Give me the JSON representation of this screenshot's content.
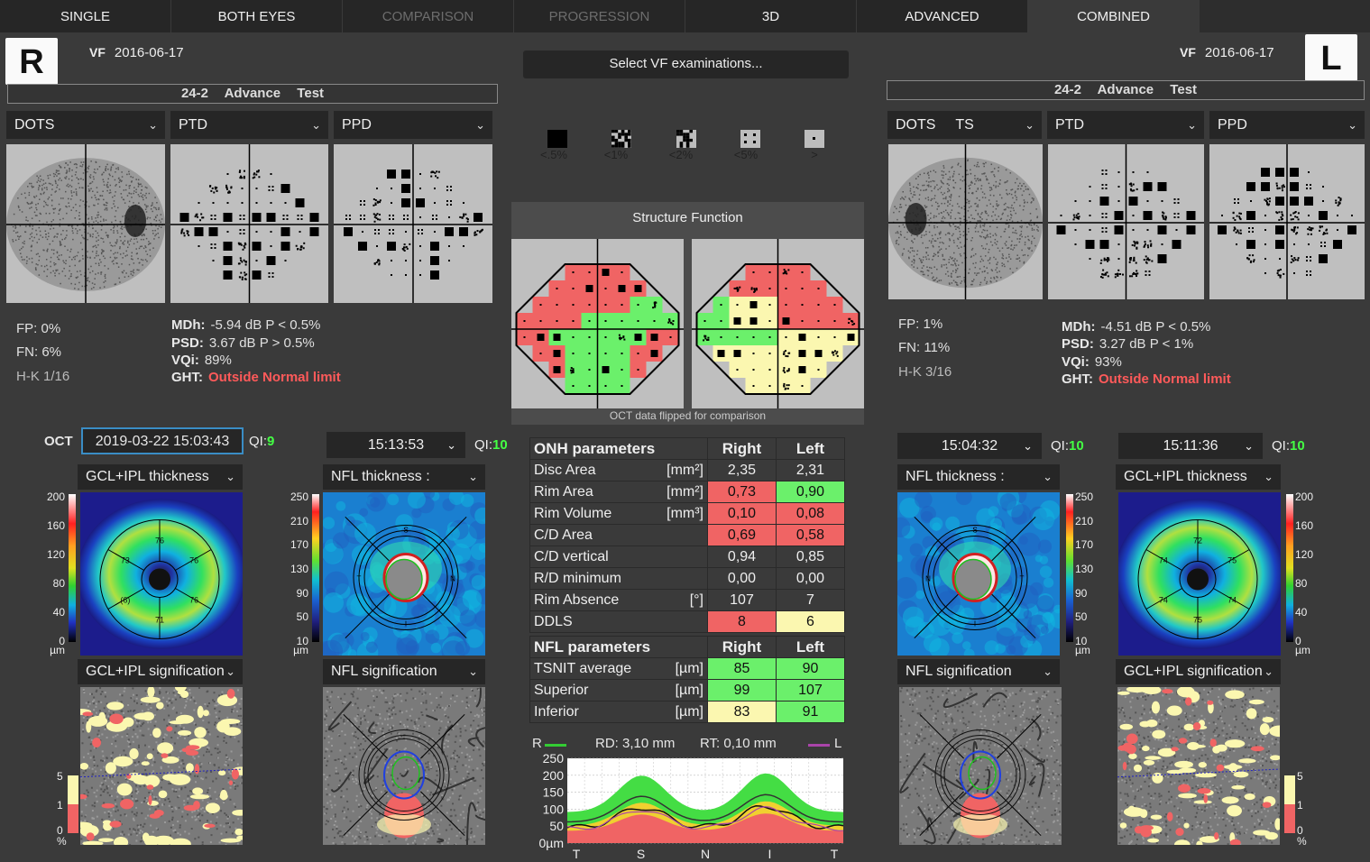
{
  "tabs": [
    {
      "label": "SINGLE",
      "state": "normal"
    },
    {
      "label": "BOTH EYES",
      "state": "normal"
    },
    {
      "label": "COMPARISON",
      "state": "disabled"
    },
    {
      "label": "PROGRESSION",
      "state": "disabled"
    },
    {
      "label": "3D",
      "state": "normal"
    },
    {
      "label": "ADVANCED",
      "state": "normal"
    },
    {
      "label": "COMBINED",
      "state": "active"
    }
  ],
  "right_eye": {
    "letter": "R",
    "vf_label": "VF",
    "vf_date": "2016-06-17",
    "test": "24-2 Advance Test",
    "dropdowns": [
      "DOTS",
      "PTD",
      "PPD"
    ],
    "fp": "FP:  0%",
    "fn": "FN:  6%",
    "hk": "H-K  1/16",
    "mdh_label": "MDh:",
    "mdh": "-5.94 dB P < 0.5%",
    "psd_label": "PSD:",
    "psd": "3.67 dB P > 0.5%",
    "vqi_label": "VQi:",
    "vqi": "89%",
    "ght_label": "GHT:",
    "ght": "Outside Normal limit"
  },
  "left_eye": {
    "letter": "L",
    "vf_label": "VF",
    "vf_date": "2016-06-17",
    "test": "24-2 Advance Test",
    "dropdowns": [
      "DOTS     TS",
      "PTD",
      "PPD"
    ],
    "fp": "FP:  1%",
    "fn": "FN:  11%",
    "hk": "H-K  3/16",
    "mdh_label": "MDh:",
    "mdh": "-4.51 dB P < 0.5%",
    "psd_label": "PSD:",
    "psd": "3.27 dB P < 1%",
    "vqi_label": "VQi:",
    "vqi": "93%",
    "ght_label": "GHT:",
    "ght": "Outside Normal limit"
  },
  "center": {
    "select_button": "Select VF examinations...",
    "prob_legend": [
      "<.5%",
      "<1%",
      "<2%",
      "<5%",
      ">"
    ],
    "structure_function": "Structure Function",
    "flip_note": "OCT data flipped for comparison"
  },
  "oct": {
    "label": "OCT",
    "date": "2019-03-22 15:03:43",
    "qi_label": "QI:",
    "qi_main": "9",
    "r_time": "15:13:53",
    "r_qi": "10",
    "l_time1": "15:04:32",
    "l_qi1": "10",
    "l_time2": "15:11:36",
    "l_qi2": "10",
    "gcl_thickness": "GCL+IPL thickness",
    "nfl_thickness": "NFL thickness :",
    "gcl_sig": "GCL+IPL signification",
    "nfl_sig": "NFL signification",
    "gcl_scale": [
      "200",
      "160",
      "120",
      "80",
      "40",
      "0",
      "µm"
    ],
    "nfl_scale": [
      "250",
      "210",
      "170",
      "130",
      "90",
      "50",
      "10",
      "µm"
    ],
    "sig_scale": [
      "5",
      "1",
      "0",
      "%"
    ],
    "r_gcl_sectors": [
      "76",
      "76",
      "76",
      "71",
      "(6)",
      "73"
    ],
    "l_gcl_sectors": [
      "72",
      "75",
      "74",
      "75",
      "74",
      "74"
    ]
  },
  "onh": {
    "header": [
      "ONH parameters",
      "Right",
      "Left"
    ],
    "rows": [
      {
        "name": "Disc Area",
        "unit": "[mm²]",
        "r": "2,35",
        "l": "2,31",
        "rc": "n",
        "lc": "n"
      },
      {
        "name": "Rim Area",
        "unit": "[mm²]",
        "r": "0,73",
        "l": "0,90",
        "rc": "r",
        "lc": "g"
      },
      {
        "name": "Rim Volume",
        "unit": "[mm³]",
        "r": "0,10",
        "l": "0,08",
        "rc": "r",
        "lc": "r"
      },
      {
        "name": "C/D Area",
        "unit": "",
        "r": "0,69",
        "l": "0,58",
        "rc": "r",
        "lc": "r"
      },
      {
        "name": "C/D vertical",
        "unit": "",
        "r": "0,94",
        "l": "0,85",
        "rc": "n",
        "lc": "n"
      },
      {
        "name": "R/D minimum",
        "unit": "",
        "r": "0,00",
        "l": "0,00",
        "rc": "n",
        "lc": "n"
      },
      {
        "name": "Rim Absence",
        "unit": "[°]",
        "r": "107",
        "l": "7",
        "rc": "n",
        "lc": "n"
      },
      {
        "name": "DDLS",
        "unit": "",
        "r": "8",
        "l": "6",
        "rc": "r",
        "lc": "y"
      }
    ]
  },
  "nfl": {
    "header": [
      "NFL parameters",
      "Right",
      "Left"
    ],
    "rows": [
      {
        "name": "TSNIT average",
        "unit": "[µm]",
        "r": "85",
        "l": "90",
        "rc": "g",
        "lc": "g"
      },
      {
        "name": "Superior",
        "unit": "[µm]",
        "r": "99",
        "l": "107",
        "rc": "g",
        "lc": "g"
      },
      {
        "name": "Inferior",
        "unit": "[µm]",
        "r": "83",
        "l": "91",
        "rc": "y",
        "lc": "g"
      }
    ]
  },
  "tsnit": {
    "r_label": "R",
    "l_label": "L",
    "rd": "RD: 3,10 mm",
    "rt": "RT: 0,10 mm",
    "yticks": [
      "250",
      "200",
      "150",
      "100",
      "50",
      "0µm"
    ],
    "xticks": [
      "T",
      "S",
      "N",
      "I",
      "T"
    ],
    "colors": {
      "right": "#33cc33",
      "left": "#aa44aa"
    }
  }
}
